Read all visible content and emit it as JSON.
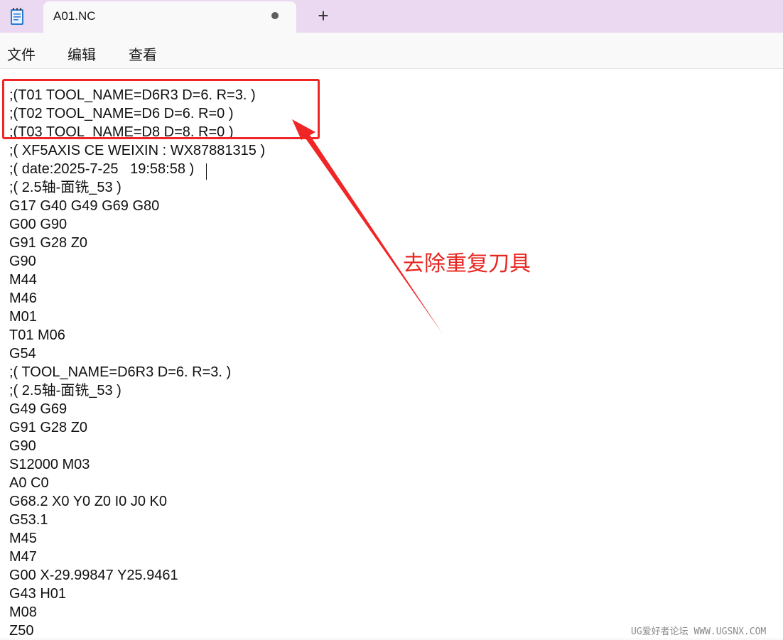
{
  "tab": {
    "title": "A01.NC"
  },
  "new_tab_label": "+",
  "menu": {
    "file": "文件",
    "edit": "编辑",
    "view": "查看"
  },
  "editor_lines": [
    ";(T01 TOOL_NAME=D6R3 D=6. R=3. )",
    ";(T02 TOOL_NAME=D6 D=6. R=0 )",
    ";(T03 TOOL_NAME=D8 D=8. R=0 )",
    ";( XF5AXIS CE WEIXIN : WX87881315 )",
    ";( date:2025-7-25   19:58:58 )",
    ";( 2.5轴-面铣_53 )",
    "G17 G40 G49 G69 G80",
    "G00 G90",
    "G91 G28 Z0",
    "G90",
    "M44",
    "M46",
    "M01",
    "T01 M06",
    "G54",
    ";( TOOL_NAME=D6R3 D=6. R=3. )",
    ";( 2.5轴-面铣_53 )",
    "G49 G69",
    "G91 G28 Z0",
    "G90",
    "S12000 M03",
    "A0 C0",
    "G68.2 X0 Y0 Z0 I0 J0 K0",
    "G53.1",
    "M45",
    "M47",
    "G00 X-29.99847 Y25.9461",
    "G43 H01",
    "M08",
    "Z50"
  ],
  "annotation": {
    "text": "去除重复刀具",
    "color": "#e8261f"
  },
  "watermark": "UG爱好者论坛 WWW.UGSNX.COM",
  "colors": {
    "tabbar_bg": "#ead9f0",
    "editor_bg": "#ffffff",
    "annotation_red": "#f02525"
  },
  "icons": {
    "app": "notepad-icon",
    "unsaved": "unsaved-dot-icon"
  }
}
